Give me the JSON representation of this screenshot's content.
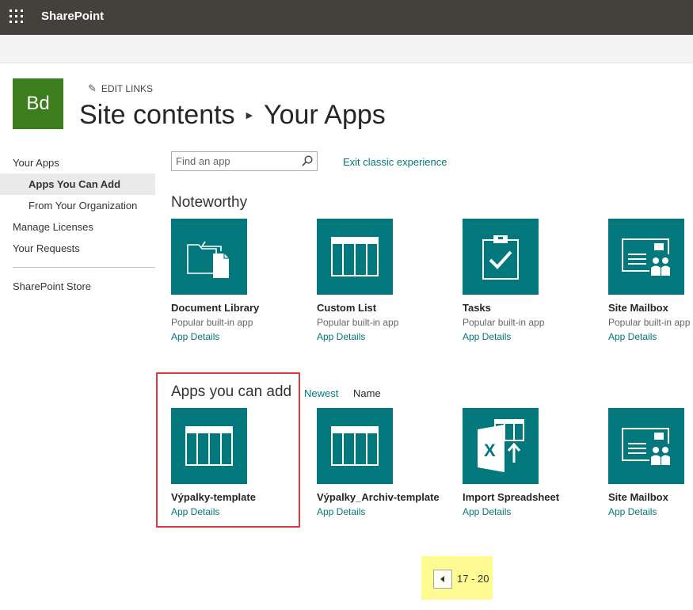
{
  "suite_bar": {
    "app_name": "SharePoint",
    "waffle_icon": "waffle-icon"
  },
  "site": {
    "logo_text": "Bd",
    "logo_color": "#3c7e1e",
    "edit_links_label": "EDIT LINKS"
  },
  "title": {
    "parent": "Site contents",
    "current": "Your Apps"
  },
  "left_nav": {
    "items": [
      {
        "label": "Your Apps",
        "level": 0,
        "selected": false
      },
      {
        "label": "Apps You Can Add",
        "level": 1,
        "selected": true
      },
      {
        "label": "From Your Organization",
        "level": 1,
        "selected": false
      },
      {
        "label": "Manage Licenses",
        "level": 0,
        "selected": false
      },
      {
        "label": "Your Requests",
        "level": 0,
        "selected": false
      }
    ],
    "store_label": "SharePoint Store"
  },
  "search": {
    "placeholder": "Find an app"
  },
  "exit_classic_label": "Exit classic experience",
  "noteworthy": {
    "title": "Noteworthy",
    "apps": [
      {
        "name": "Document Library",
        "desc": "Popular built-in app",
        "details": "App Details",
        "icon": "document-library-icon"
      },
      {
        "name": "Custom List",
        "desc": "Popular built-in app",
        "details": "App Details",
        "icon": "custom-list-icon"
      },
      {
        "name": "Tasks",
        "desc": "Popular built-in app",
        "details": "App Details",
        "icon": "tasks-icon"
      },
      {
        "name": "Site Mailbox",
        "desc": "Popular built-in app",
        "details": "App Details",
        "icon": "site-mailbox-icon"
      }
    ]
  },
  "apps_you_can_add": {
    "title": "Apps you can add",
    "sort_newest": "Newest",
    "sort_name": "Name",
    "apps": [
      {
        "name": "Výpalky-template",
        "details": "App Details",
        "icon": "custom-list-icon"
      },
      {
        "name": "Výpalky_Archiv-template",
        "details": "App Details",
        "icon": "custom-list-icon"
      },
      {
        "name": "Import Spreadsheet",
        "details": "App Details",
        "icon": "import-spreadsheet-icon"
      },
      {
        "name": "Site Mailbox",
        "details": "App Details",
        "icon": "site-mailbox-icon"
      }
    ]
  },
  "pager": {
    "range": "17 - 20"
  },
  "colors": {
    "accent": "#03787c",
    "suite_bar": "#44403c",
    "highlight_box": "#e0383e",
    "pager_highlight": "#fdfb91"
  }
}
